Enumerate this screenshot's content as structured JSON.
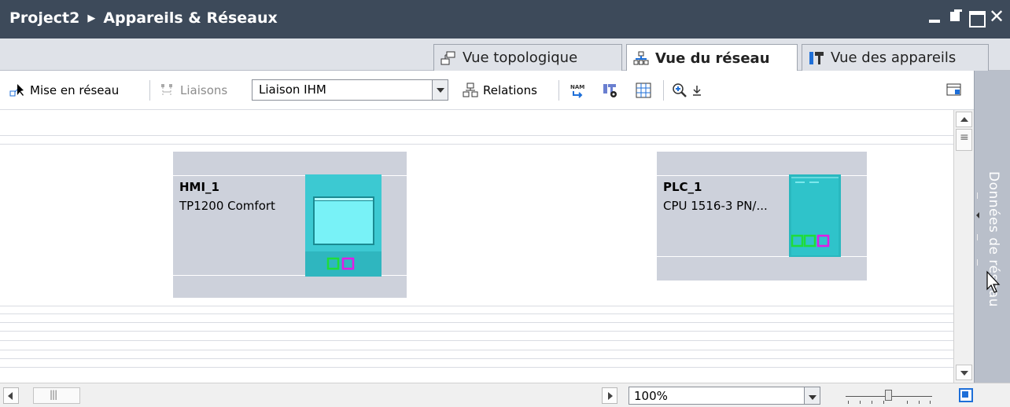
{
  "window": {
    "breadcrumb": [
      "Project2",
      "Appareils & Réseaux"
    ],
    "separator": "▶"
  },
  "tabs": [
    {
      "label": "Vue topologique",
      "icon": "topology-view-icon",
      "active": false
    },
    {
      "label": "Vue du réseau",
      "icon": "network-view-icon",
      "active": true
    },
    {
      "label": "Vue des appareils",
      "icon": "device-view-icon",
      "active": false
    }
  ],
  "toolbar": {
    "network_label": "Mise en réseau",
    "connections_label": "Liaisons",
    "connection_type_value": "Liaison IHM",
    "relations_label": "Relations",
    "zoom_icon": "zoom-in-icon"
  },
  "devices": [
    {
      "name": "HMI_1",
      "type": "TP1200 Comfort"
    },
    {
      "name": "PLC_1",
      "type": "CPU 1516-3 PN/..."
    }
  ],
  "side_panel": {
    "label": "Données de réseau"
  },
  "status": {
    "zoom_value": "100%"
  },
  "colors": {
    "title_bar": "#3d4a5a",
    "device_box": "#cdd1db",
    "hmi_device": "#3cc9d2",
    "hmi_screen": "#78f2f7",
    "plc_device": "#29b8bf",
    "port_green": "#1fdc3a",
    "port_magenta": "#e21be5",
    "side_panel": "#b9bfca"
  }
}
